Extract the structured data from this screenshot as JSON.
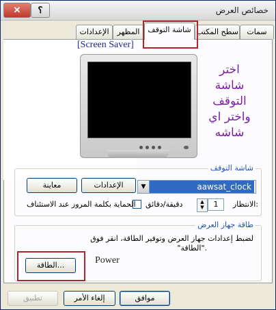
{
  "window": {
    "title": "خصائص العرض",
    "close_glyph": "✕",
    "help_glyph": "؟"
  },
  "tabs": [
    {
      "label": "سمات"
    },
    {
      "label": "سطح المكتب"
    },
    {
      "label": "شاشة التوقف"
    },
    {
      "label": "المظهر"
    },
    {
      "label": "الإعدادات"
    }
  ],
  "preview": {
    "caption": "[Screen Saver]",
    "note_lines": [
      "اختر",
      "شاشة",
      "التوقف",
      "واختر اي",
      "شاشه"
    ]
  },
  "screensaver": {
    "group_label": "شاشة التوقف",
    "selected": "aawsat_clock",
    "settings_button": "الإعدادات",
    "preview_button": "معاينة",
    "wait_label": "الانتظار:",
    "wait_value": "1",
    "minutes_label": "دقيقة/دقائق",
    "password_label": "الحماية بكلمة المرور عند الاستئناف"
  },
  "power": {
    "group_label": "طاقة جهاز العرض",
    "description_line1": "لضبط إعدادات جهاز العرض وتوفير الطاقة، انقر فوق",
    "description_line2": "\"الطاقة\".",
    "button": "الطاقة...",
    "annotation": "Power"
  },
  "footer": {
    "ok": "موافق",
    "cancel": "إلغاء الأمر",
    "apply": "تطبيق"
  },
  "colors": {
    "accent": "#316ac5",
    "highlight": "#b0242c",
    "note": "#7a1fa2"
  }
}
